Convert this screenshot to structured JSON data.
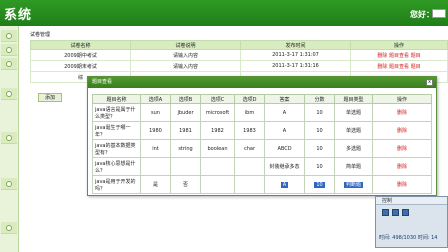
{
  "header": {
    "title": "系统",
    "greeting": "您好："
  },
  "panel": {
    "title": "试卷管理",
    "add_label": "添加"
  },
  "papers": {
    "headers": [
      "试卷名称",
      "试卷说明",
      "发布时间",
      "操作"
    ],
    "rows": [
      {
        "name": "2009期中考试",
        "desc": "请输入内容",
        "time": "2011-3-17 1:31:07",
        "ops": "删除 题目查看 题目"
      },
      {
        "name": "2009期末考试",
        "desc": "请输入内容",
        "time": "2011-3-17 1:31:16",
        "ops": "删除 题目查看 题目"
      },
      {
        "name": "综",
        "desc": "",
        "time": "",
        "ops": ""
      }
    ]
  },
  "dialog": {
    "title": "题目查看",
    "close": "x",
    "headers": [
      "题目名称",
      "选项A",
      "选项B",
      "选项C",
      "选项D",
      "答案",
      "分数",
      "题目类型",
      "操作"
    ],
    "rows": [
      {
        "q": "java语言是属于什么类型？",
        "a": "sun",
        "b": "jbuder",
        "c": "microsoft",
        "d": "ibm",
        "ans": "A",
        "score": "10",
        "type": "单选题",
        "op": "删除"
      },
      {
        "q": "java诞生于哪一年？",
        "a": "1980",
        "b": "1981",
        "c": "1982",
        "d": "1983",
        "ans": "A",
        "score": "10",
        "type": "单选题",
        "op": "删除"
      },
      {
        "q": "java的基本数据类型有？",
        "a": "int",
        "b": "string",
        "c": "boolean",
        "d": "char",
        "ans": "ABCD",
        "score": "10",
        "type": "多选题",
        "op": "删除"
      },
      {
        "q": "java核心思想是什么？",
        "a": "",
        "b": "",
        "c": "",
        "d": "",
        "ans": "封装继承多态",
        "score": "10",
        "type": "简单题",
        "op": "删除"
      },
      {
        "q": "java是用于开发的吗？",
        "a": "是",
        "b": "否",
        "c": "",
        "d": "",
        "ans": "A",
        "score": "10",
        "type": "判断题",
        "op": "删除"
      }
    ]
  },
  "control": {
    "title": "控制",
    "time": "时间: 498/1030 时间: 14"
  }
}
